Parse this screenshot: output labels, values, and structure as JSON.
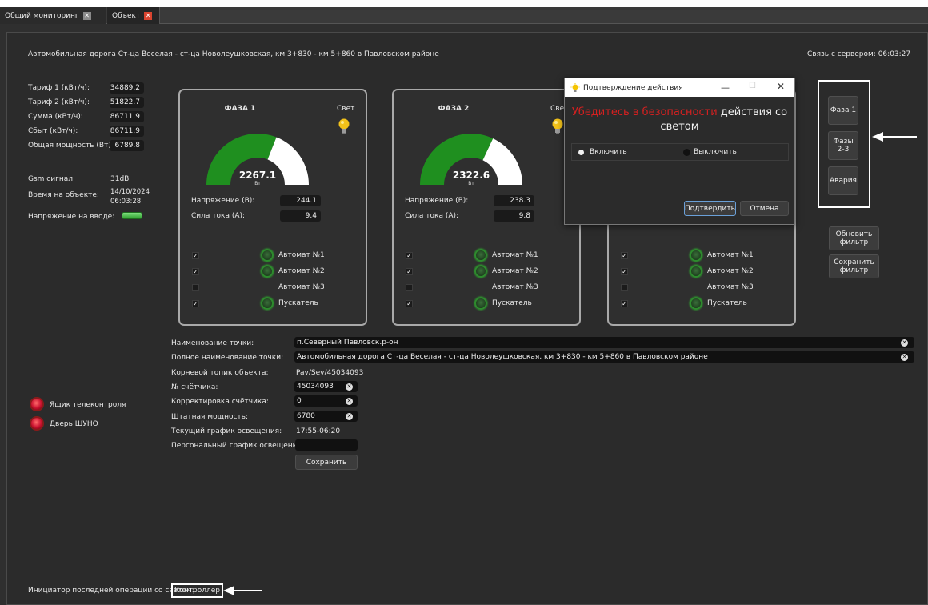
{
  "tabs": [
    {
      "label": "Общий мониторинг",
      "active": false
    },
    {
      "label": "Объект",
      "active": true
    }
  ],
  "header": {
    "object_title": "Автомобильная дорога Ст-ца Веселая - ст-ца Новолеушковская, км 3+830 - км 5+860 в Павловском районе",
    "server_link": "Связь с сервером: 06:03:27"
  },
  "meters": [
    {
      "label": "Тариф 1 (кВт/ч):",
      "value": "34889.2"
    },
    {
      "label": "Тариф 2 (кВт/ч):",
      "value": "51822.7"
    },
    {
      "label": "Сумма (кВт/ч):",
      "value": "86711.9"
    },
    {
      "label": "Сбыт (кВт/ч):",
      "value": "86711.9"
    },
    {
      "label": "Общая мощность (Вт):",
      "value": "6789.8"
    }
  ],
  "status": {
    "gsm_label": "Gsm сигнал:",
    "gsm_value": "31dB",
    "time_label": "Время на объекте:",
    "time_date": "14/10/2024",
    "time_clock": "06:03:28",
    "input_voltage_label": "Напряжение на вводе:"
  },
  "phases": [
    {
      "title": "ФАЗА 1",
      "light_label": "Свет",
      "power": "2267.1",
      "unit": "Вт",
      "fill": 0.62,
      "voltage_label": "Напряжение (В):",
      "voltage": "244.1",
      "current_label": "Сила тока (А):",
      "current": "9.4",
      "rows": [
        {
          "checked": true,
          "led": true,
          "label": "Автомат №1"
        },
        {
          "checked": true,
          "led": true,
          "label": "Автомат №2"
        },
        {
          "checked": false,
          "led": false,
          "label": "Автомат №3"
        },
        {
          "checked": true,
          "led": true,
          "label": "Пускатель"
        }
      ]
    },
    {
      "title": "ФАЗА 2",
      "light_label": "Све",
      "power": "2322.6",
      "unit": "Вт",
      "fill": 0.64,
      "voltage_label": "Напряжение (В):",
      "voltage": "238.3",
      "current_label": "Сила тока (А):",
      "current": "9.8",
      "rows": [
        {
          "checked": true,
          "led": true,
          "label": "Автомат №1"
        },
        {
          "checked": true,
          "led": true,
          "label": "Автомат №2"
        },
        {
          "checked": false,
          "led": false,
          "label": "Автомат №3"
        },
        {
          "checked": true,
          "led": true,
          "label": "Пускатель"
        }
      ]
    },
    {
      "title": "",
      "light_label": "",
      "power": "",
      "unit": "",
      "fill": 0,
      "voltage_label": "",
      "voltage": "",
      "current_label": "",
      "current": "",
      "rows": [
        {
          "checked": true,
          "led": true,
          "label": "Автомат №1"
        },
        {
          "checked": true,
          "led": true,
          "label": "Автомат №2"
        },
        {
          "checked": false,
          "led": false,
          "label": "Автомат №3"
        },
        {
          "checked": true,
          "led": true,
          "label": "Пускатель"
        }
      ]
    }
  ],
  "sensors": [
    {
      "label": "Ящик телеконтроля"
    },
    {
      "label": "Дверь ШУНО"
    }
  ],
  "info": {
    "point_name_label": "Наименование точки:",
    "point_name": "п.Северный Павловск.р-он",
    "full_name_label": "Полное наименование точки:",
    "full_name": "Автомобильная дорога Ст-ца Веселая - ст-ца Новолеушковская, км 3+830 - км 5+860 в Павловском районе",
    "topic_label": "Корневой топик объекта:",
    "topic": "Pav/Sev/45034093",
    "meter_no_label": "№ счётчика:",
    "meter_no": "45034093",
    "correction_label": "Корректировка счётчика:",
    "correction": "0",
    "rated_power_label": "Штатная мощность:",
    "rated_power": "6780",
    "schedule_label": "Текущий график освещения:",
    "schedule": "17:55-06:20",
    "personal_schedule_label": "Персональный график освещения",
    "personal_schedule": "",
    "save_label": "Сохранить"
  },
  "side_buttons": {
    "phase1": "Фаза 1",
    "phases23_line1": "Фазы",
    "phases23_line2": "2-3",
    "emergency": "Авария",
    "refresh_line1": "Обновить",
    "refresh_line2": "фильтр",
    "save_filter_line1": "Сохранить",
    "save_filter_line2": "фильтр"
  },
  "dialog": {
    "title": "Подтверждение действия",
    "warning_red": "Убедитесь в безопасности",
    "warning_rest": " действия со",
    "warning_line2": "светом",
    "option_on": "Включить",
    "option_off": "Выключить",
    "selected": "on",
    "confirm": "Подтвердить",
    "cancel": "Отмена",
    "min_icon": "minimize-icon",
    "max_icon": "maximize-icon",
    "close_icon": "close-icon"
  },
  "footer": {
    "initiator_label": "Инициатор последней операции со светом:",
    "initiator_value": "Контроллер"
  },
  "colors": {
    "gauge_green": "#1f8f1f",
    "gauge_white": "#ffffff",
    "warning_red": "#d42020",
    "tab_close_active": "#d9442f"
  }
}
